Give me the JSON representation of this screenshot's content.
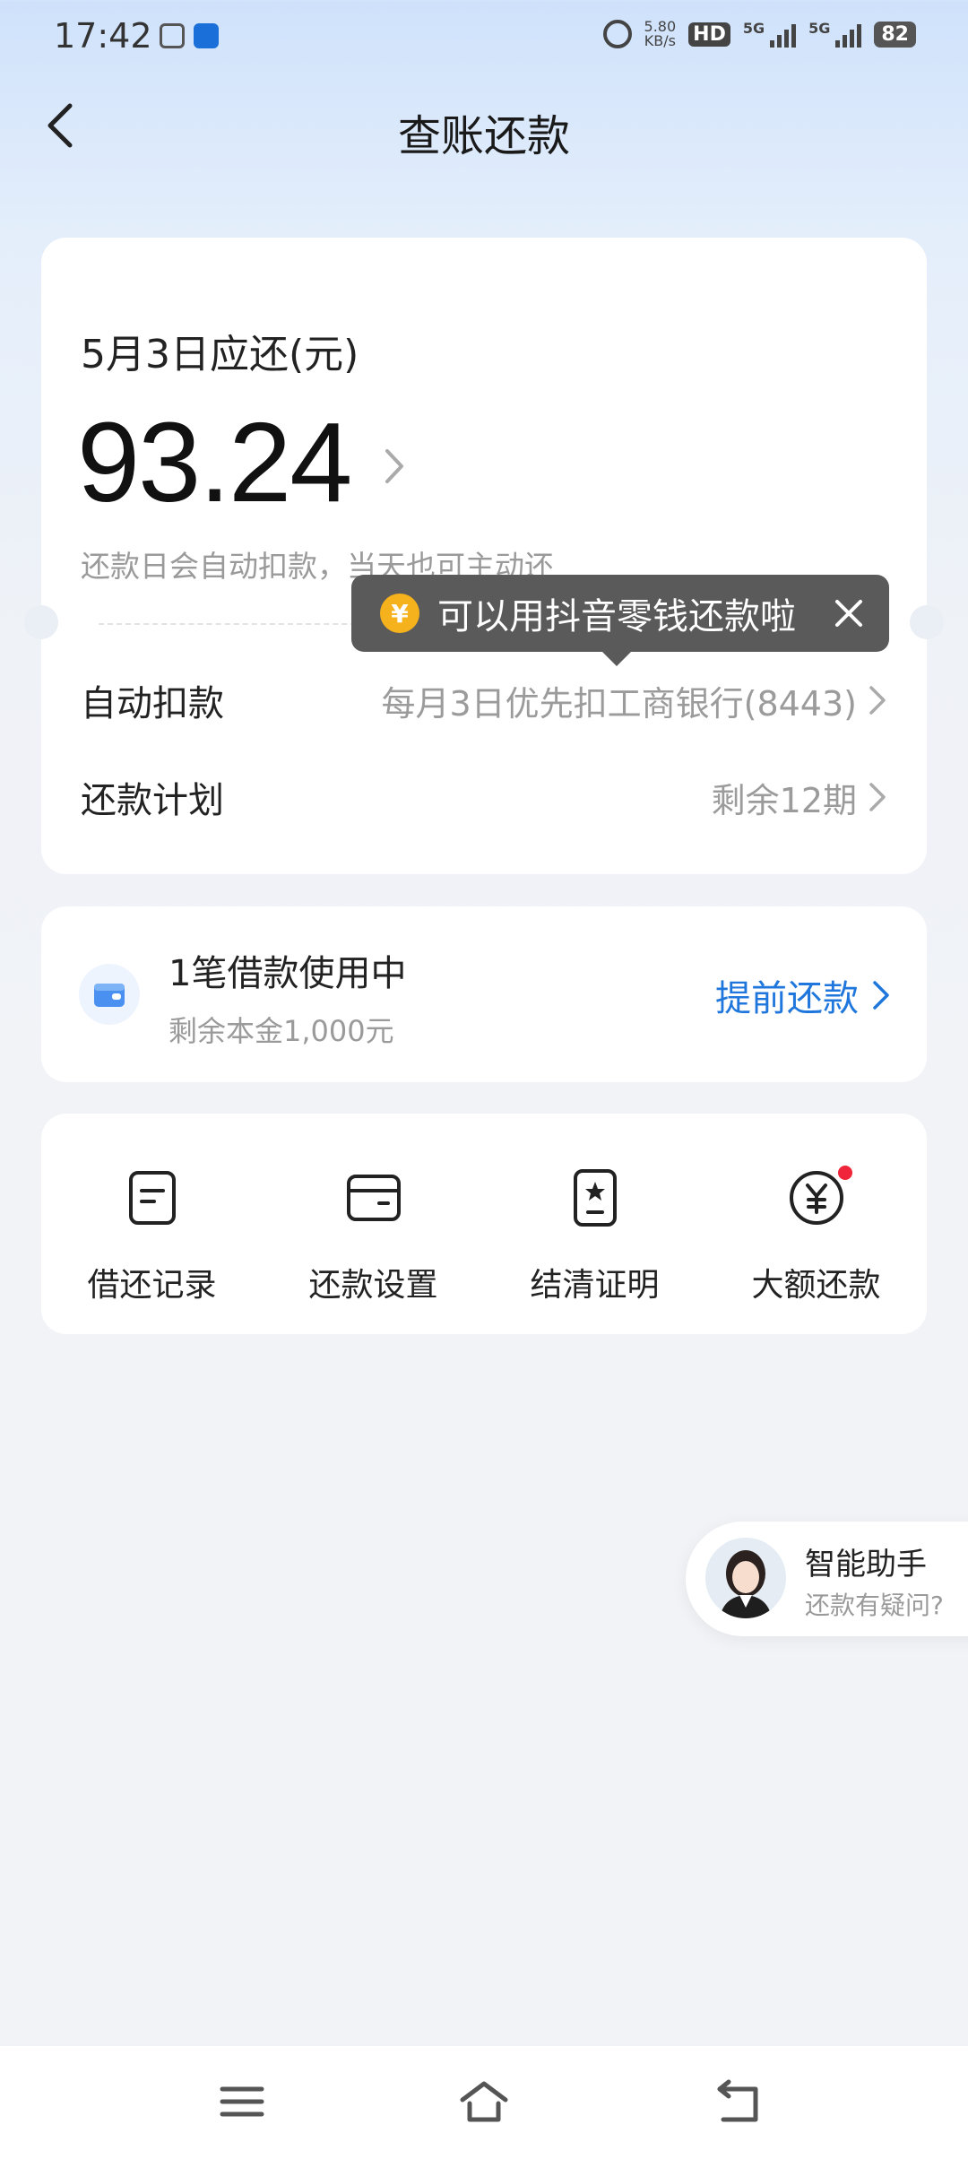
{
  "status_bar": {
    "time": "17:42",
    "net_speed_value": "5.80",
    "net_speed_unit": "KB/s",
    "hd_label": "HD",
    "signal1_label": "5G",
    "signal2_label": "5G",
    "battery": "82"
  },
  "header": {
    "title": "查账还款"
  },
  "bill": {
    "due_label": "5月3日应还(元)",
    "amount": "93.24",
    "auto_note": "还款日会自动扣款，当天也可主动还",
    "tooltip_text": "可以用抖音零钱还款啦",
    "coin_symbol": "¥",
    "auto_deduct_label": "自动扣款",
    "auto_deduct_value": "每月3日优先扣工商银行(8443)",
    "plan_label": "还款计划",
    "plan_value": "剩余12期"
  },
  "loan": {
    "title": "1笔借款使用中",
    "subtitle": "剩余本金1,000元",
    "action": "提前还款"
  },
  "grid": {
    "items": [
      {
        "label": "借还记录",
        "icon": "record-icon"
      },
      {
        "label": "还款设置",
        "icon": "card-settings-icon"
      },
      {
        "label": "结清证明",
        "icon": "certificate-icon"
      },
      {
        "label": "大额还款",
        "icon": "yuan-coin-icon"
      }
    ]
  },
  "assistant": {
    "title": "智能助手",
    "subtitle": "还款有疑问?"
  },
  "colors": {
    "accent": "#1f76dc",
    "tooltip_bg": "#5a5a5a",
    "coin": "#f5b21c",
    "badge": "#f0243a"
  }
}
